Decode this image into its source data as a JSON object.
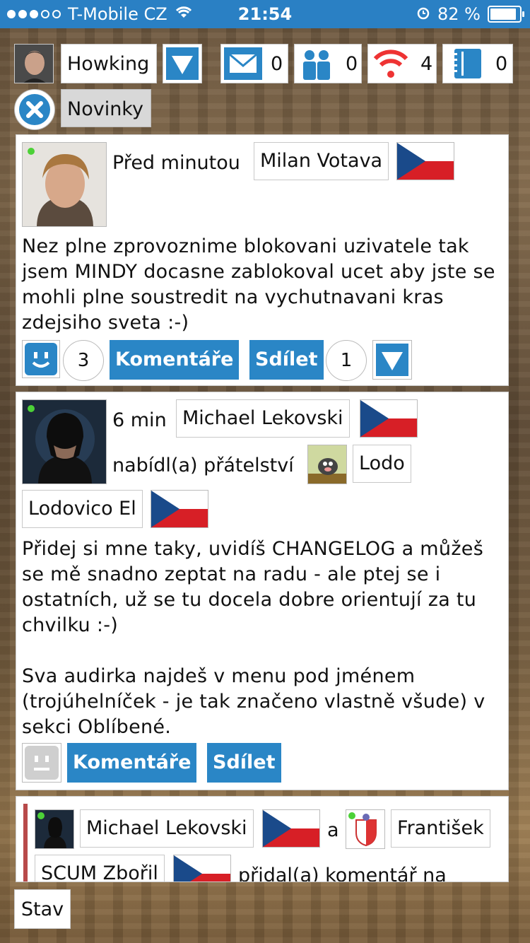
{
  "status": {
    "carrier": "T-Mobile CZ",
    "time": "21:54",
    "battery": "82 %"
  },
  "header": {
    "username": "Howking",
    "mail_count": "0",
    "friends_count": "0",
    "online_count": "4",
    "notes_count": "0",
    "section": "Novinky"
  },
  "posts": [
    {
      "time": "Před minutou",
      "author": "Milan Votava",
      "text": "Nez plne zprovoznime blokovani uzivatele tak jsem MINDY docasne zablokoval ucet aby jste se mohli plne soustredit na vychutnavani kras zdejsiho sveta :-)",
      "likes": "3",
      "comments_label": "Komentáře",
      "share_label": "Sdílet",
      "shares": "1"
    },
    {
      "time": "6 min",
      "author": "Michael Lekovski",
      "action": "nabídl(a) přátelství",
      "target": "Lodo",
      "target_full": "Lodovico El",
      "text1": "Přidej si mne taky, uvidíš CHANGELOG a můžeš se mě snadno zeptat na radu - ale ptej se i ostatních, už se tu docela dobre orientují za tu chvilku :-)",
      "text2": "Sva audirka najdeš v menu pod jménem (trojúhelníček - je tak značeno vlastně všude) v sekci Oblíbené.",
      "comments_label": "Komentáře",
      "share_label": "Sdílet"
    },
    {
      "author": "Michael Lekovski",
      "and": "a",
      "other": "František",
      "other2": "SCUM Zbořil",
      "action": "přidal(a) komentář na"
    }
  ],
  "footer": {
    "status_button": "Stav"
  }
}
